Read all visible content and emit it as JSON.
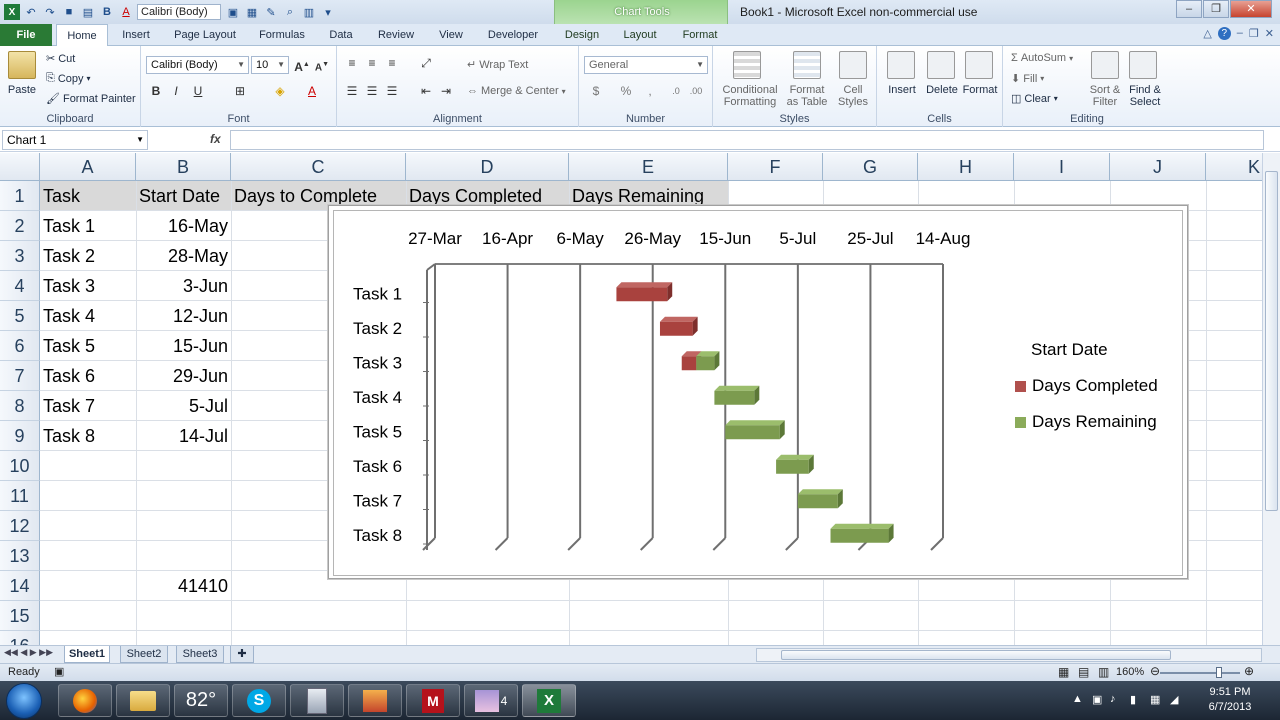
{
  "window": {
    "title": "Book1 - Microsoft Excel non-commercial use",
    "context_tab_group": "Chart Tools",
    "qat_font": "Calibri (Body)",
    "minimize": "–",
    "restore": "❐",
    "close": "✕"
  },
  "ribbon": {
    "tabs": [
      "File",
      "Home",
      "Insert",
      "Page Layout",
      "Formulas",
      "Data",
      "Review",
      "View",
      "Developer",
      "Design",
      "Layout",
      "Format"
    ],
    "clipboard": {
      "paste": "Paste",
      "cut": "Cut",
      "copy": "Copy",
      "format_painter": "Format Painter",
      "label": "Clipboard"
    },
    "font": {
      "name": "Calibri (Body)",
      "size": "10",
      "bold": "B",
      "italic": "I",
      "underline": "U",
      "label": "Font"
    },
    "alignment": {
      "wrap_text": "Wrap Text",
      "merge_center": "Merge & Center",
      "label": "Alignment"
    },
    "number": {
      "format": "General",
      "currency": "$",
      "percent": "%",
      "comma": ",",
      "label": "Number"
    },
    "styles": {
      "conditional": "Conditional\nFormatting",
      "format_table": "Format\nas Table",
      "cell_styles": "Cell\nStyles",
      "label": "Styles"
    },
    "cells": {
      "insert": "Insert",
      "delete": "Delete",
      "format": "Format",
      "label": "Cells"
    },
    "editing": {
      "autosum": "AutoSum",
      "fill": "Fill",
      "clear": "Clear",
      "sort_filter": "Sort &\nFilter",
      "find_select": "Find &\nSelect",
      "label": "Editing"
    }
  },
  "formula_bar": {
    "name_box": "Chart 1",
    "fx": "fx",
    "value": ""
  },
  "sheet": {
    "columns": [
      "A",
      "B",
      "C",
      "D",
      "E",
      "F",
      "G",
      "H",
      "I",
      "J",
      "K"
    ],
    "rows": [
      "1",
      "2",
      "3",
      "4",
      "5",
      "6",
      "7",
      "8",
      "9",
      "10",
      "11",
      "12",
      "13",
      "14",
      "15",
      "16"
    ],
    "headers": [
      "Task",
      "Start Date",
      "Days to Complete",
      "Days Completed",
      "Days Remaining"
    ],
    "tasks": [
      "Task 1",
      "Task 2",
      "Task 3",
      "Task 4",
      "Task 5",
      "Task 6",
      "Task 7",
      "Task 8"
    ],
    "start_dates": [
      "16-May",
      "28-May",
      "3-Jun",
      "12-Jun",
      "15-Jun",
      "29-Jun",
      "5-Jul",
      "14-Jul"
    ],
    "b14": "41410"
  },
  "chart_data": {
    "type": "bar",
    "orientation": "horizontal",
    "style": "3d-stacked-gantt",
    "categories": [
      "Task 1",
      "Task 2",
      "Task 3",
      "Task 4",
      "Task 5",
      "Task 6",
      "Task 7",
      "Task 8"
    ],
    "x_ticks": [
      "27-Mar",
      "16-Apr",
      "6-May",
      "26-May",
      "15-Jun",
      "5-Jul",
      "25-Jul",
      "14-Aug"
    ],
    "x_tick_values": [
      41360,
      41380,
      41400,
      41420,
      41440,
      41460,
      41480,
      41500
    ],
    "xlim": [
      41360,
      41500
    ],
    "legend_position": "right",
    "series": [
      {
        "name": "Start Date",
        "values": [
          41410,
          41422,
          41428,
          41437,
          41440,
          41454,
          41460,
          41469
        ],
        "visible": false
      },
      {
        "name": "Days Completed",
        "values": [
          14,
          9,
          4,
          0,
          0,
          0,
          0,
          0
        ],
        "color": "#b0504d"
      },
      {
        "name": "Days Remaining",
        "values": [
          0,
          0,
          5,
          11,
          15,
          9,
          11,
          16
        ],
        "color": "#8bab5a"
      }
    ]
  },
  "sheet_tabs": [
    "Sheet1",
    "Sheet2",
    "Sheet3"
  ],
  "status": {
    "ready": "Ready",
    "zoom": "160%"
  },
  "taskbar": {
    "weather": "82°",
    "time": "9:51 PM",
    "date": "6/7/2013",
    "badge": "4"
  }
}
